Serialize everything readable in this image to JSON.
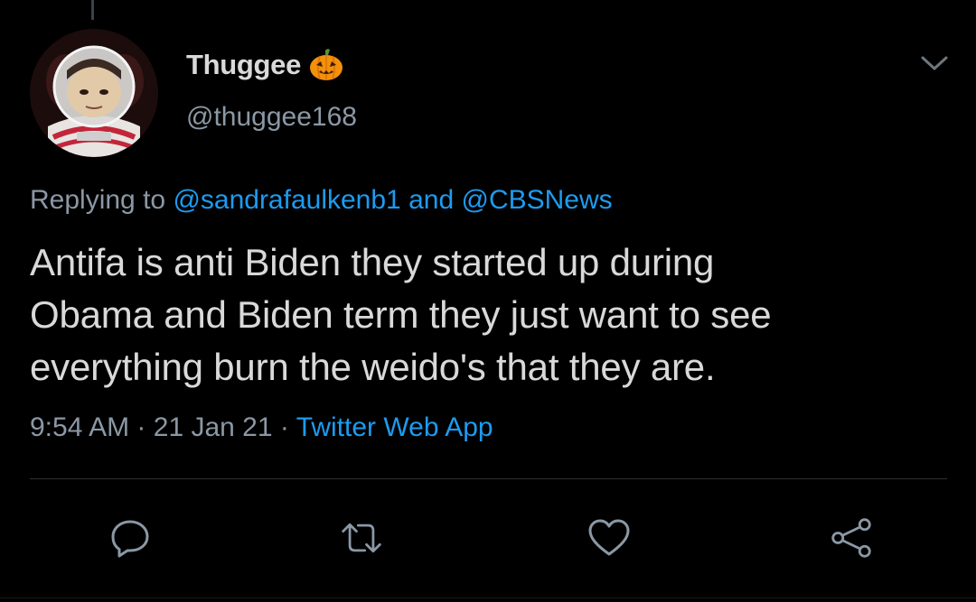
{
  "tweet": {
    "display_name": "Thuggee",
    "handle": "@thuggee168",
    "reply": {
      "prefix": "Replying to",
      "user1": "@sandrafaulkenb1",
      "joiner": "and",
      "user2": "@CBSNews"
    },
    "text": "Antifa is anti Biden they started up during\nObama and Biden term they just want to see\neverything burn the weido's that they are.",
    "time": "9:54 AM",
    "date": "21 Jan 21",
    "separator": "·",
    "source": "Twitter Web App"
  },
  "icons": {
    "name_emoji": "jack-o-lantern-icon",
    "menu": "chevron-down-icon",
    "actions": [
      "reply-icon",
      "retweet-icon",
      "like-icon",
      "share-icon"
    ]
  },
  "colors": {
    "background": "#000000",
    "primary_text": "#d9d9d9",
    "secondary_text": "#8b98a5",
    "link": "#1d9bf0",
    "divider": "#2f3336",
    "pumpkin": "#f4900c"
  }
}
